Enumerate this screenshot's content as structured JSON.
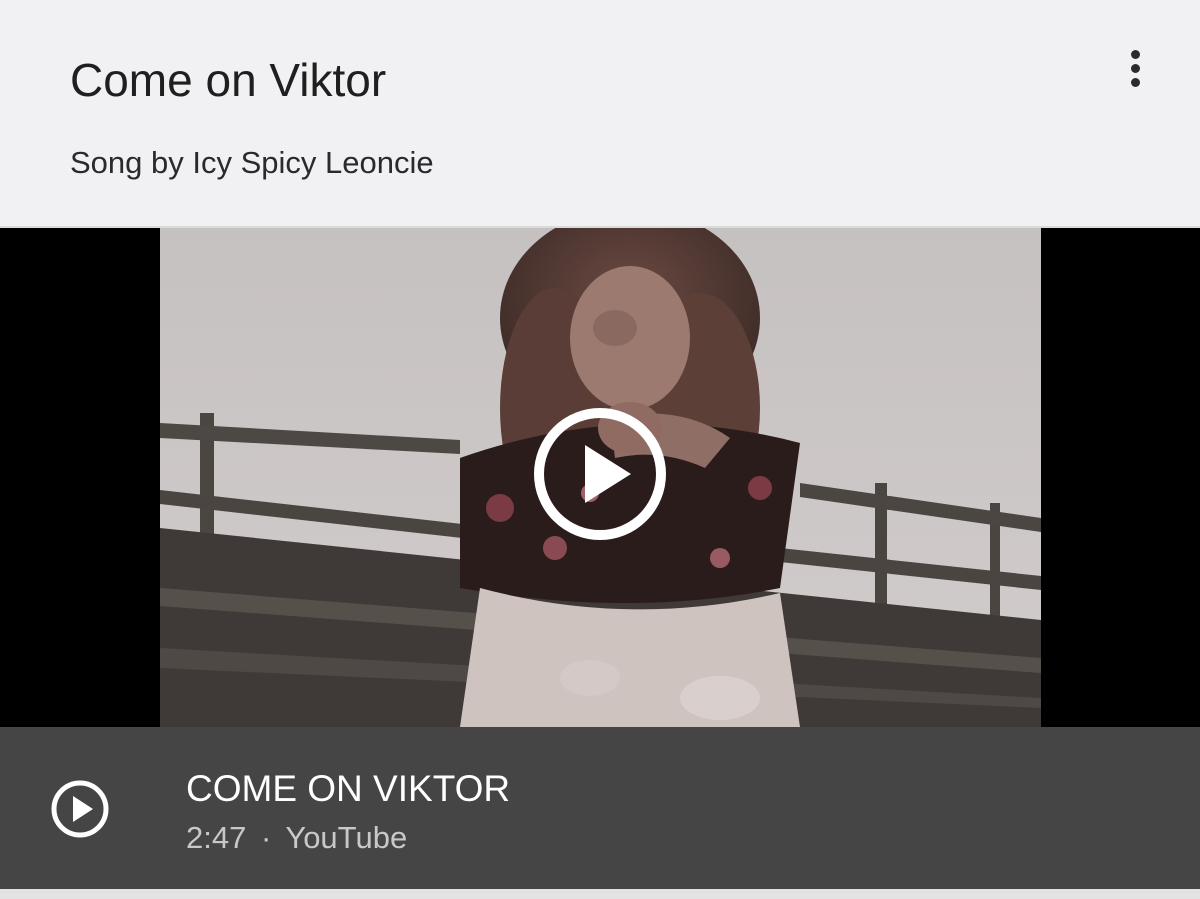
{
  "card": {
    "title": "Come on Viktor",
    "subtitle": "Song by Icy Spicy Leoncie",
    "menu_icon": "more-vert-icon"
  },
  "video": {
    "title": "COME ON VIKTOR",
    "duration": "2:47",
    "separator": "·",
    "source": "YouTube",
    "play_icon": "play-circle-icon"
  },
  "colors": {
    "header_bg": "#f1f1f3",
    "bar_bg": "#454545",
    "player_bg": "#000000"
  }
}
